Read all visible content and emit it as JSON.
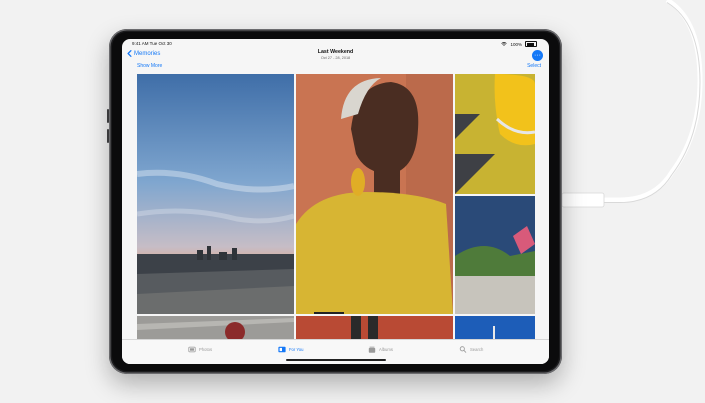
{
  "status": {
    "time": "9:41 AM  Tue Oct 30",
    "battery": "100%"
  },
  "nav": {
    "back_label": "Memories",
    "title": "Last Weekend",
    "subtitle": "Oct 27 - 28, 2018"
  },
  "toolbar": {
    "show_more": "Show More",
    "select": "Select"
  },
  "photos": [
    {
      "id": "city-skyline"
    },
    {
      "id": "woman-portrait"
    },
    {
      "id": "yellow-car"
    },
    {
      "id": "blue-wall"
    },
    {
      "id": "rooftop-person"
    },
    {
      "id": "red-brick"
    },
    {
      "id": "blue-sky"
    }
  ],
  "tabs": [
    {
      "label": "Photos",
      "icon": "photos-icon",
      "active": false
    },
    {
      "label": "For You",
      "icon": "for-you-icon",
      "active": true
    },
    {
      "label": "Albums",
      "icon": "albums-icon",
      "active": false
    },
    {
      "label": "Search",
      "icon": "search-icon",
      "active": false
    }
  ],
  "colors": {
    "accent": "#1478f7",
    "shirt": "#d7b533",
    "backdrop": "#c97452"
  }
}
